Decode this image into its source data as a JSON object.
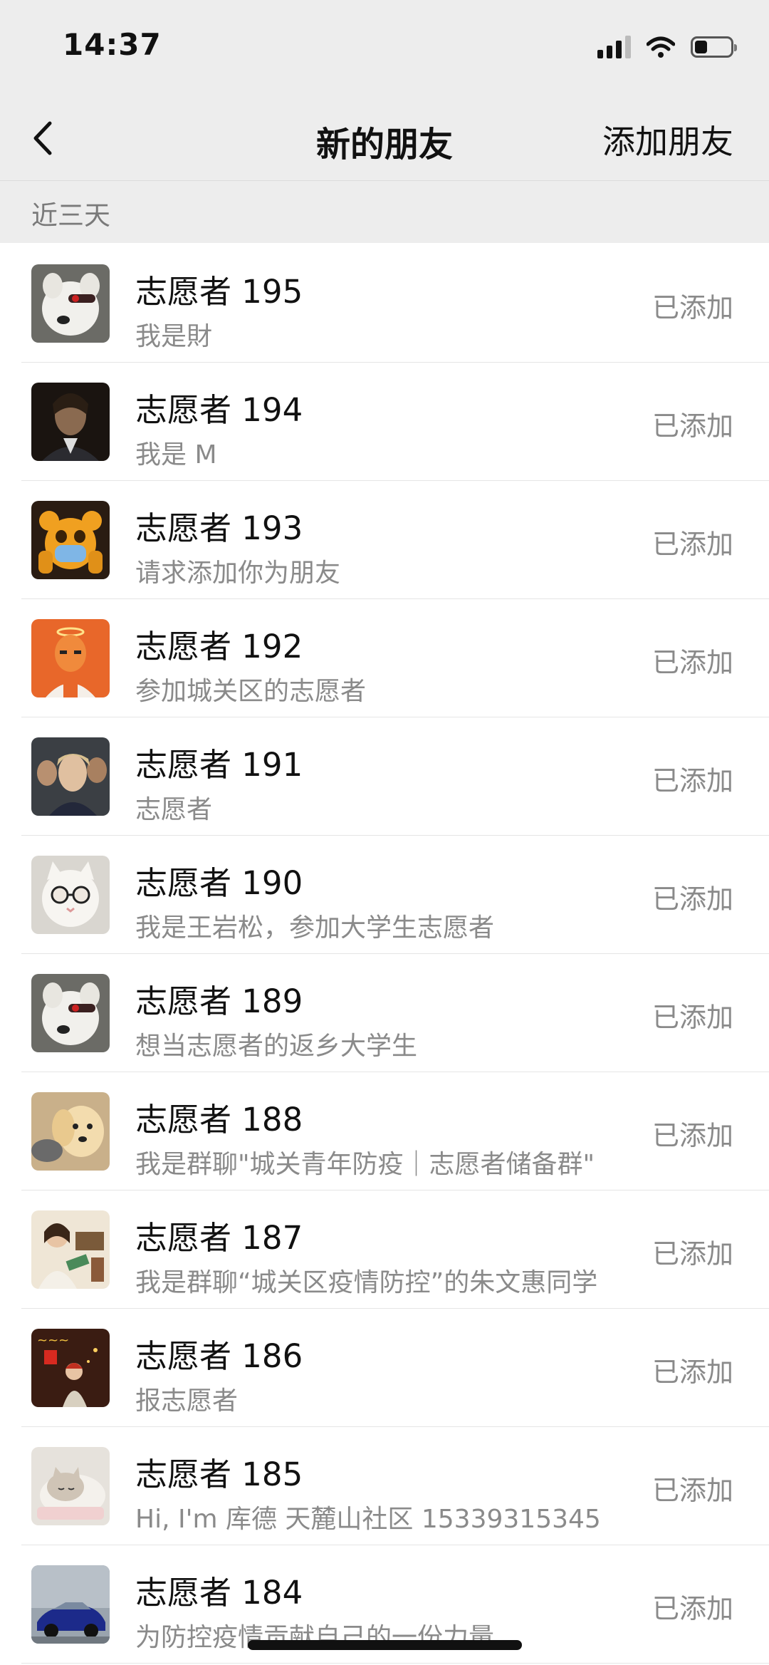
{
  "status_bar": {
    "time": "14:37",
    "battery_level": 0.35
  },
  "nav": {
    "title": "新的朋友",
    "action": "添加朋友"
  },
  "section": {
    "label": "近三天"
  },
  "friends": [
    {
      "name": "志愿者 195",
      "message": "我是財",
      "status": "已添加",
      "avatar": "white-dog-avatar"
    },
    {
      "name": "志愿者 194",
      "message": "我是 M",
      "status": "已添加",
      "avatar": "dark-portrait-avatar"
    },
    {
      "name": "志愿者 193",
      "message": "请求添加你为朋友",
      "status": "已添加",
      "avatar": "masked-bear-avatar"
    },
    {
      "name": "志愿者 192",
      "message": "参加城关区的志愿者",
      "status": "已添加",
      "avatar": "orange-character-avatar"
    },
    {
      "name": "志愿者 191",
      "message": "志愿者",
      "status": "已添加",
      "avatar": "movie-portrait-avatar"
    },
    {
      "name": "志愿者 190",
      "message": "我是王岩松，参加大学生志愿者",
      "status": "已添加",
      "avatar": "cat-sunglasses-avatar"
    },
    {
      "name": "志愿者 189",
      "message": "想当志愿者的返乡大学生",
      "status": "已添加",
      "avatar": "white-dog-avatar"
    },
    {
      "name": "志愿者 188",
      "message": "我是群聊\"城关青年防疫｜志愿者储备群\"",
      "status": "已添加",
      "avatar": "puppy-avatar"
    },
    {
      "name": "志愿者 187",
      "message": "我是群聊“城关区疫情防控”的朱文惠同学",
      "status": "已添加",
      "avatar": "illustration-girl-avatar"
    },
    {
      "name": "志愿者 186",
      "message": "报志愿者",
      "status": "已添加",
      "avatar": "festival-avatar"
    },
    {
      "name": "志愿者 185",
      "message": "Hi, I'm 库德 天麓山社区 15339315345",
      "status": "已添加",
      "avatar": "sleeping-cat-avatar"
    },
    {
      "name": "志愿者 184",
      "message": "为防控疫情贡献自己的一份力量",
      "status": "已添加",
      "avatar": "blue-car-avatar"
    }
  ],
  "colors": {
    "header_bg": "#ededed",
    "text_primary": "#111111",
    "text_secondary": "#8a8a8a"
  }
}
